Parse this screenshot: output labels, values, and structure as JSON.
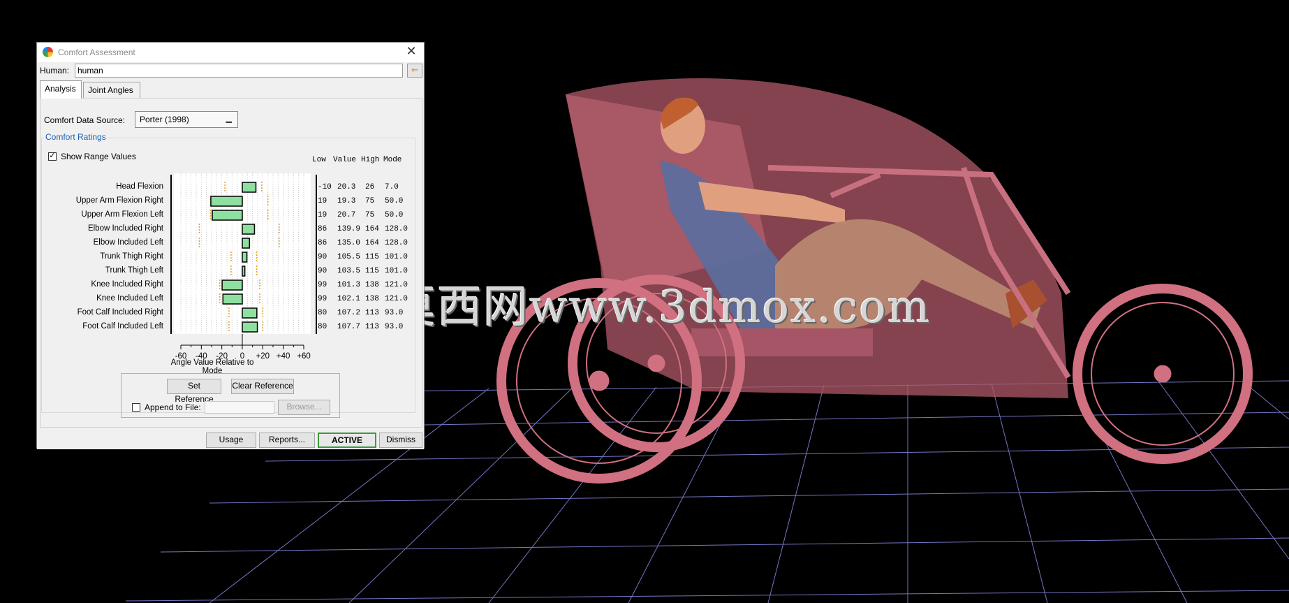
{
  "dialog": {
    "title": "Comfort Assessment",
    "human_label": "Human:",
    "human_value": "human",
    "tabs": [
      "Analysis",
      "Joint Angles"
    ],
    "data_source_label": "Comfort Data Source:",
    "data_source_value": "Porter (1998)",
    "ratings_group_label": "Comfort Ratings",
    "show_range_label": "Show Range Values",
    "show_range_checked": true,
    "column_headers": [
      "Low",
      "Value",
      "High",
      "Mode"
    ],
    "axis_title": "Angle Value Relative to Mode",
    "set_reference_label": "Set Reference",
    "clear_reference_label": "Clear Reference",
    "append_label": "Append to File:",
    "browse_label": "Browse...",
    "bottom_buttons": [
      "Usage",
      "Reports...",
      "ACTIVE",
      "Dismiss"
    ]
  },
  "chart_data": {
    "type": "bar",
    "orientation": "horizontal",
    "xlabel": "Angle Value Relative to Mode",
    "xlim": [
      -60,
      60
    ],
    "xticks": [
      "-60",
      "-40",
      "-20",
      "0",
      "+20",
      "+40",
      "+60"
    ],
    "bar_color": "#8ee0a0",
    "range_color": "#e0a030",
    "categories": [
      "Head Flexion",
      "Upper Arm Flexion Right",
      "Upper Arm Flexion Left",
      "Elbow Included Right",
      "Elbow Included Left",
      "Trunk Thigh Right",
      "Trunk Thigh Left",
      "Knee Included Right",
      "Knee Included Left",
      "Foot Calf Included Right",
      "Foot Calf Included Left"
    ],
    "values": [
      13.3,
      -30.7,
      -29.3,
      11.9,
      7.0,
      4.5,
      2.5,
      -19.7,
      -18.9,
      14.2,
      14.7
    ],
    "table": [
      [
        "-10",
        "20.3",
        "26",
        "7.0"
      ],
      [
        "19",
        "19.3",
        "75",
        "50.0"
      ],
      [
        "19",
        "20.7",
        "75",
        "50.0"
      ],
      [
        "86",
        "139.9",
        "164",
        "128.0"
      ],
      [
        "86",
        "135.0",
        "164",
        "128.0"
      ],
      [
        "90",
        "105.5",
        "115",
        "101.0"
      ],
      [
        "90",
        "103.5",
        "115",
        "101.0"
      ],
      [
        "99",
        "101.3",
        "138",
        "121.0"
      ],
      [
        "99",
        "102.1",
        "138",
        "121.0"
      ],
      [
        "80",
        "107.2",
        "113",
        "93.0"
      ],
      [
        "80",
        "107.7",
        "113",
        "93.0"
      ]
    ]
  },
  "viewport": {
    "watermark": "莫西网www.3dmox.com"
  }
}
